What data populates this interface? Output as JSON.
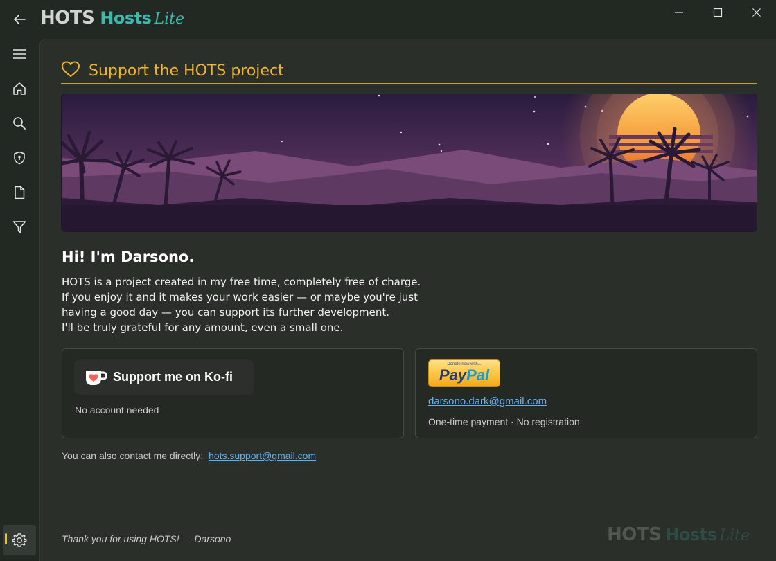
{
  "app": {
    "brand_part1": "HOTS",
    "brand_part2": "Hosts",
    "brand_part3": "Lite"
  },
  "sidebar": {
    "items": [
      {
        "icon": "menu-icon"
      },
      {
        "icon": "home-icon"
      },
      {
        "icon": "search-icon"
      },
      {
        "icon": "shield-icon"
      },
      {
        "icon": "file-icon"
      },
      {
        "icon": "filter-icon"
      },
      {
        "icon": "gear-icon"
      }
    ]
  },
  "page": {
    "title": "Support the HOTS project",
    "greeting": "Hi! I'm Darsono.",
    "intro_lines": [
      "HOTS is a project created in my free time, completely free of charge.",
      "If you enjoy it and it makes your work easier — or maybe you're just",
      "having a good day — you can support its further development.",
      "I'll be truly grateful for any amount, even a small one."
    ]
  },
  "kofi": {
    "button_label": "Support me on Ko-fi",
    "note": "No account needed"
  },
  "paypal": {
    "badge_top": "Donate now with...",
    "badge_pay": "Pay",
    "badge_pal": "Pal",
    "email": "darsono.dark@gmail.com",
    "note": "One-time payment · No registration"
  },
  "contact": {
    "text": "You can also contact me directly:",
    "email": "hots.support@gmail.com"
  },
  "footer": {
    "thanks": "Thank you for using HOTS! — Darsono"
  },
  "colors": {
    "accent": "#f0b32d",
    "link": "#63aef0",
    "brand_teal": "#3fb5ab",
    "active_indicator": "#f3c200"
  }
}
